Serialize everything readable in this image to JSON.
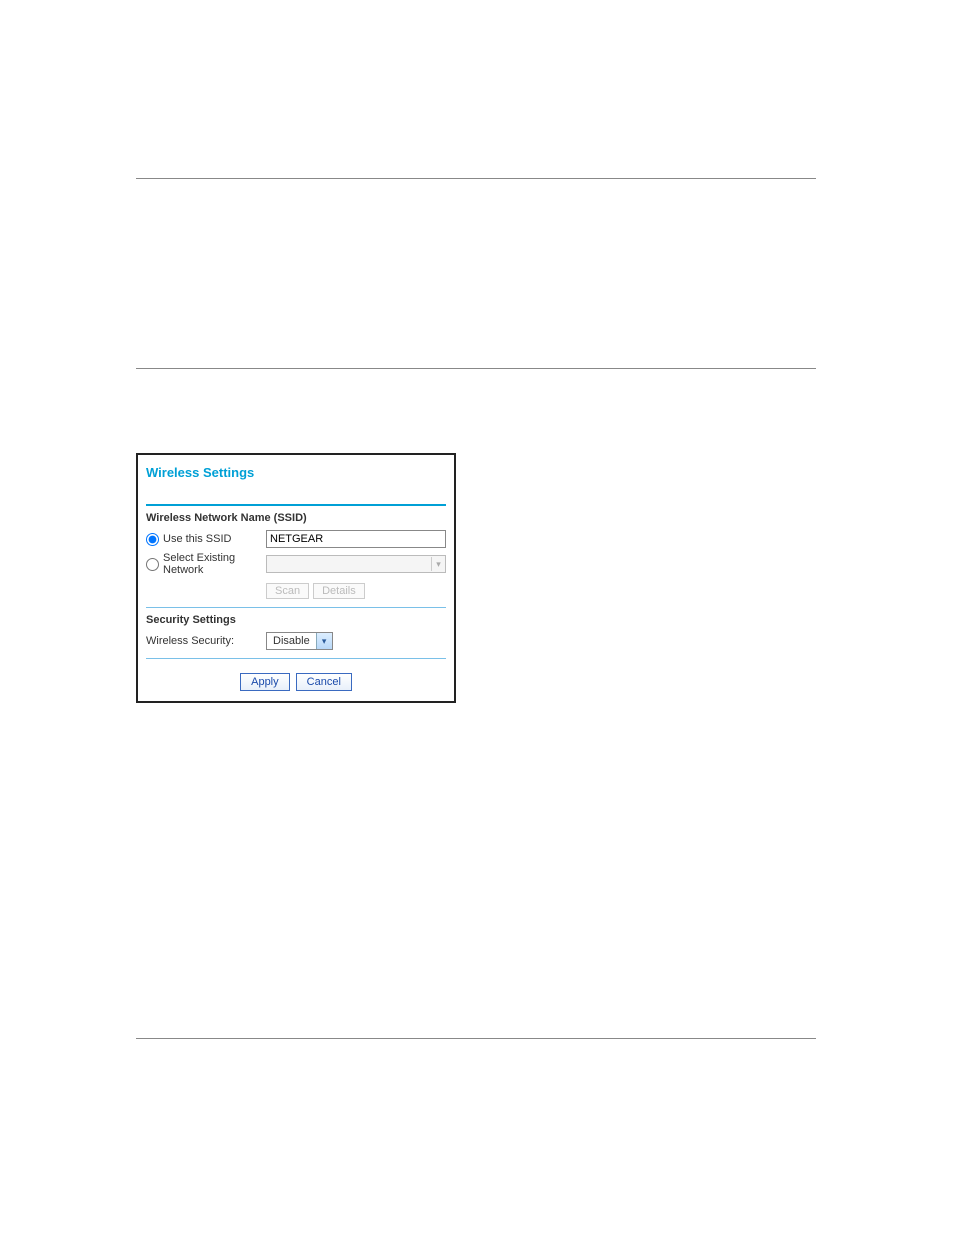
{
  "panel": {
    "title": "Wireless Settings",
    "ssid_section": {
      "heading": "Wireless Network Name (SSID)",
      "use_ssid_label": "Use this SSID",
      "ssid_value": "NETGEAR",
      "select_existing_label": "Select Existing Network",
      "scan_label": "Scan",
      "details_label": "Details"
    },
    "security_section": {
      "heading": "Security Settings",
      "wireless_security_label": "Wireless Security:",
      "security_value": "Disable"
    },
    "buttons": {
      "apply": "Apply",
      "cancel": "Cancel"
    }
  }
}
